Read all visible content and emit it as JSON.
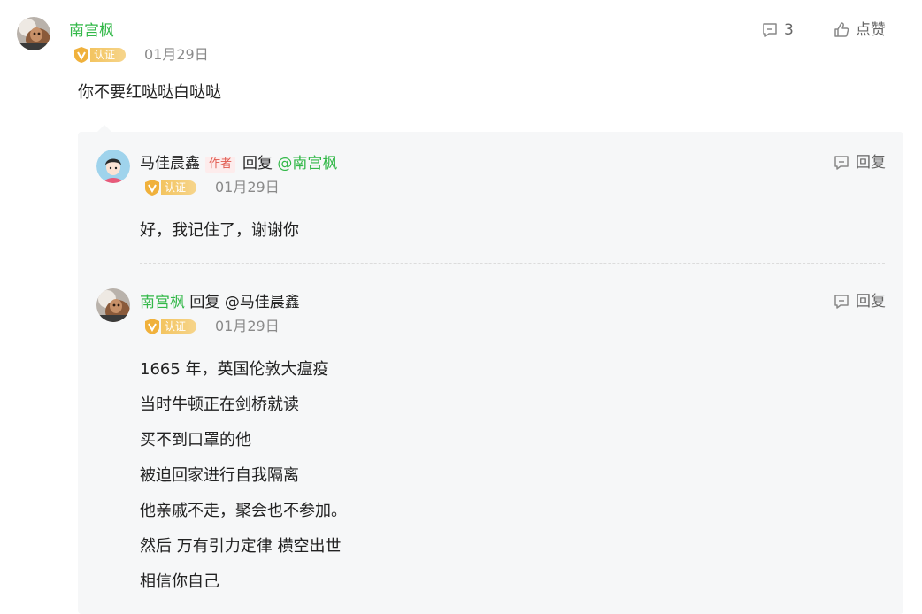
{
  "main_comment": {
    "author": "南宫枫",
    "badge": "认证",
    "date": "01月29日",
    "content": "你不要红哒哒白哒哒",
    "comment_count": "3",
    "like_label": "点赞"
  },
  "replies": [
    {
      "author": "马佳晨鑫",
      "author_tag": "作者",
      "reply_word": "回复",
      "reply_to": "@南宫枫",
      "badge": "认证",
      "date": "01月29日",
      "reply_label": "回复",
      "lines": [
        "好，我记住了，谢谢你"
      ]
    },
    {
      "author": "南宫枫",
      "reply_word": "回复",
      "reply_to": "@马佳晨鑫",
      "badge": "认证",
      "date": "01月29日",
      "reply_label": "回复",
      "lines": [
        "1665 年，英国伦敦大瘟疫",
        "当时牛顿正在剑桥就读",
        "买不到口罩的他",
        "被迫回家进行自我隔离",
        "他亲戚不走，聚会也不参加。",
        "然后 万有引力定律 横空出世",
        "相信你自己"
      ]
    }
  ],
  "colors": {
    "name_green": "#33b849",
    "badge_gold": "#f3c460",
    "author_tag_red": "#e05a4f"
  }
}
